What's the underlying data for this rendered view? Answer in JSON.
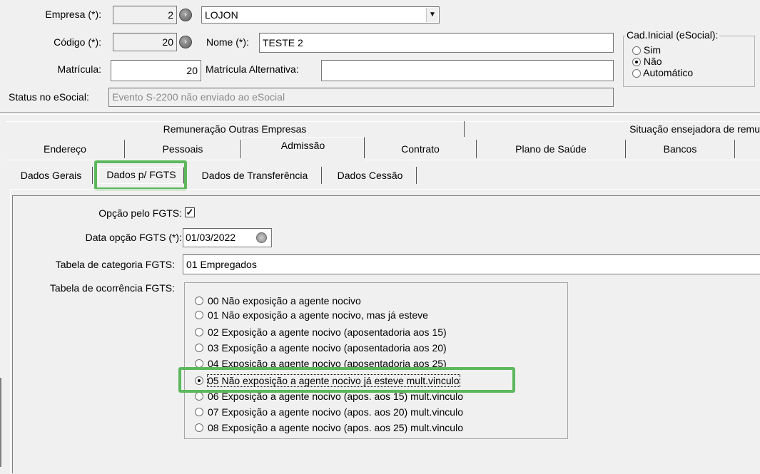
{
  "header": {
    "empresa_label": "Empresa (*):",
    "empresa_code": "2",
    "empresa_name": "LOJON",
    "codigo_label": "Código (*):",
    "codigo_value": "20",
    "nome_label": "Nome (*):",
    "nome_value": "TESTE 2",
    "matricula_label": "Matrícula:",
    "matricula_value": "20",
    "matricula_alt_label": "Matrícula Alternativa:",
    "matricula_alt_value": "",
    "status_label": "Status no eSocial:",
    "status_value": "Evento S-2200 não enviado ao eSocial"
  },
  "cad_inicial": {
    "title": "Cad.Inicial (eSocial):",
    "options": [
      "Sim",
      "Não",
      "Automático"
    ],
    "selected": "Não"
  },
  "tabs_row1": [
    "Remuneração Outras Empresas",
    "Situação ensejadora de remu"
  ],
  "tabs_row2": [
    "Endereço",
    "Pessoais",
    "Admissão",
    "Contrato",
    "Plano de Saúde",
    "Bancos"
  ],
  "tabs_row2_active": "Admissão",
  "subtabs": [
    "Dados Gerais",
    "Dados p/ FGTS",
    "Dados de Transferência",
    "Dados Cessão"
  ],
  "subtabs_active": "Dados p/ FGTS",
  "fgts": {
    "opcao_label": "Opção pelo FGTS:",
    "opcao_checked": "✓",
    "data_label": "Data opção FGTS (*):",
    "data_value": "01/03/2022",
    "categoria_label": "Tabela de categoria FGTS:",
    "categoria_value": "01 Empregados",
    "ocorrencia_label": "Tabela de ocorrência FGTS:",
    "ocorrencias": [
      "00 Não exposição a agente nocivo",
      "01 Não exposição a agente nocivo, mas já esteve",
      "02 Exposição a agente nocivo (aposentadoria aos 15)",
      "03 Exposição a agente nocivo (aposentadoria aos 20)",
      "04 Exposição a agente nocivo (aposentadoria aos 25)",
      "05 Não exposição a agente nocivo já esteve mult.vinculo",
      "06 Exposição a agente nocivo (apos. aos 15) mult.vinculo",
      "07 Exposição a agente nocivo (apos. aos 20) mult.vinculo",
      "08 Exposição a agente nocivo (apos. aos 25) mult.vinculo"
    ],
    "ocorrencia_selected_index": 5
  },
  "colors": {
    "highlight": "#5cb85c"
  }
}
